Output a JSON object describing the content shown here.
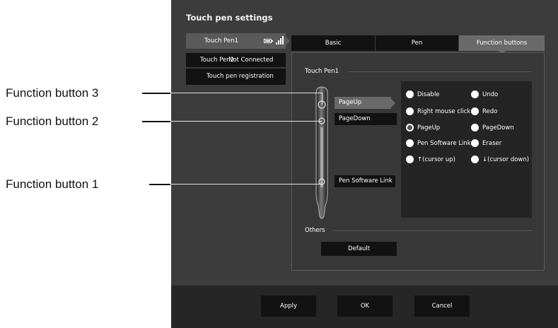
{
  "callouts": {
    "function_button_3": "Function button 3",
    "function_button_2": "Function button 2",
    "function_button_1": "Function button 1"
  },
  "window": {
    "title": "Touch pen settings"
  },
  "pen_list": {
    "pen1": {
      "label": "Touch Pen1",
      "battery_level": 1.0,
      "signal_level": 1.0
    },
    "pen2": {
      "label": "Touch Pen2",
      "status": "Not Connected"
    },
    "registration": "Touch pen registration"
  },
  "tabs": [
    {
      "label": "Basic",
      "selected": false
    },
    {
      "label": "Pen",
      "selected": false
    },
    {
      "label": "Function buttons",
      "selected": true
    }
  ],
  "content": {
    "pen_section_label": "Touch Pen1",
    "function_buttons": {
      "button3": "PageUp",
      "button2": "PageDown",
      "button1": "Pen Software Link"
    },
    "options": [
      {
        "label": "Disable",
        "selected": false
      },
      {
        "label": "Undo",
        "selected": false
      },
      {
        "label": "Right mouse click",
        "selected": false
      },
      {
        "label": "Redo",
        "selected": false
      },
      {
        "label": "PageUp",
        "selected": true
      },
      {
        "label": "PageDown",
        "selected": false
      },
      {
        "label": "Pen Software Link",
        "selected": false
      },
      {
        "label": "Eraser",
        "selected": false
      },
      {
        "label": "↑(cursor up)",
        "selected": false
      },
      {
        "label": "↓(cursor down)",
        "selected": false
      }
    ],
    "others_label": "Others",
    "default_button": "Default"
  },
  "footer": {
    "apply": "Apply",
    "ok": "OK",
    "cancel": "Cancel"
  },
  "colors": {
    "window_background": "#3c3c3c",
    "button_background": "#121212",
    "selected_tab": "#6a6a6a",
    "text": "#ffffff"
  },
  "icons": {
    "battery": "battery-icon",
    "signal": "signal-strength-icon"
  }
}
